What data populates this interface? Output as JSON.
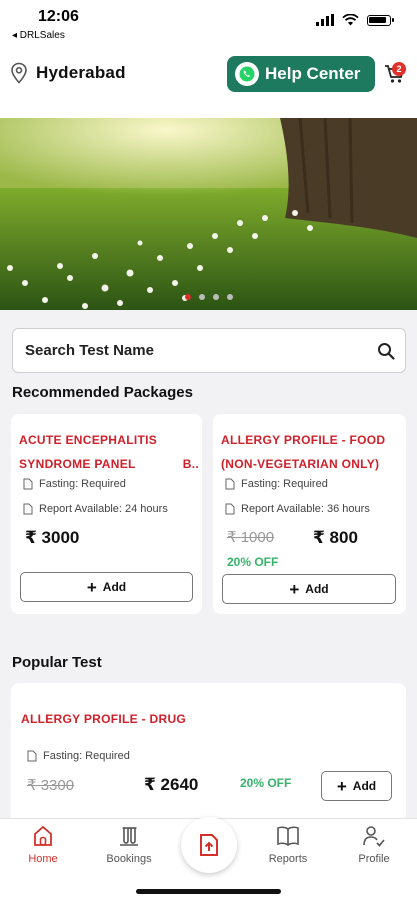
{
  "status": {
    "time": "12:06",
    "back_app": "◂ DRLSales"
  },
  "header": {
    "location": "Hyderabad",
    "help_label": "Help Center",
    "cart_count": "2"
  },
  "search": {
    "placeholder": "Search Test Name"
  },
  "recommended": {
    "title": "Recommended Packages",
    "packages": [
      {
        "name_line1": "ACUTE ENCEPHALITIS",
        "name_line2": "SYNDROME PANEL",
        "name_trunc": "B..",
        "fasting": "Fasting: Required",
        "report": "Report Available: 24 hours",
        "price": "₹ 3000",
        "add_label": "Add"
      },
      {
        "name_line1": "ALLERGY PROFILE - FOOD",
        "name_line2": "(NON-VEGETARIAN ONLY)",
        "fasting": "Fasting: Required",
        "report": "Report Available: 36 hours",
        "old_price": "₹ 1000",
        "price": "₹ 800",
        "discount": "20% OFF",
        "add_label": "Add"
      }
    ]
  },
  "popular": {
    "title": "Popular Test",
    "tests": [
      {
        "name": "ALLERGY PROFILE - DRUG",
        "fasting": "Fasting: Required",
        "old_price": "₹ 3300",
        "price": "₹ 2640",
        "discount": "20% OFF",
        "add_label": "Add"
      }
    ]
  },
  "nav": {
    "home": "Home",
    "bookings": "Bookings",
    "reports": "Reports",
    "profile": "Profile"
  },
  "colors": {
    "brand_red": "#d3302a",
    "whatsapp_green": "#1d7a5e",
    "discount_green": "#37b36a"
  },
  "banner": {
    "slide_count": 4,
    "active_slide": 1
  }
}
